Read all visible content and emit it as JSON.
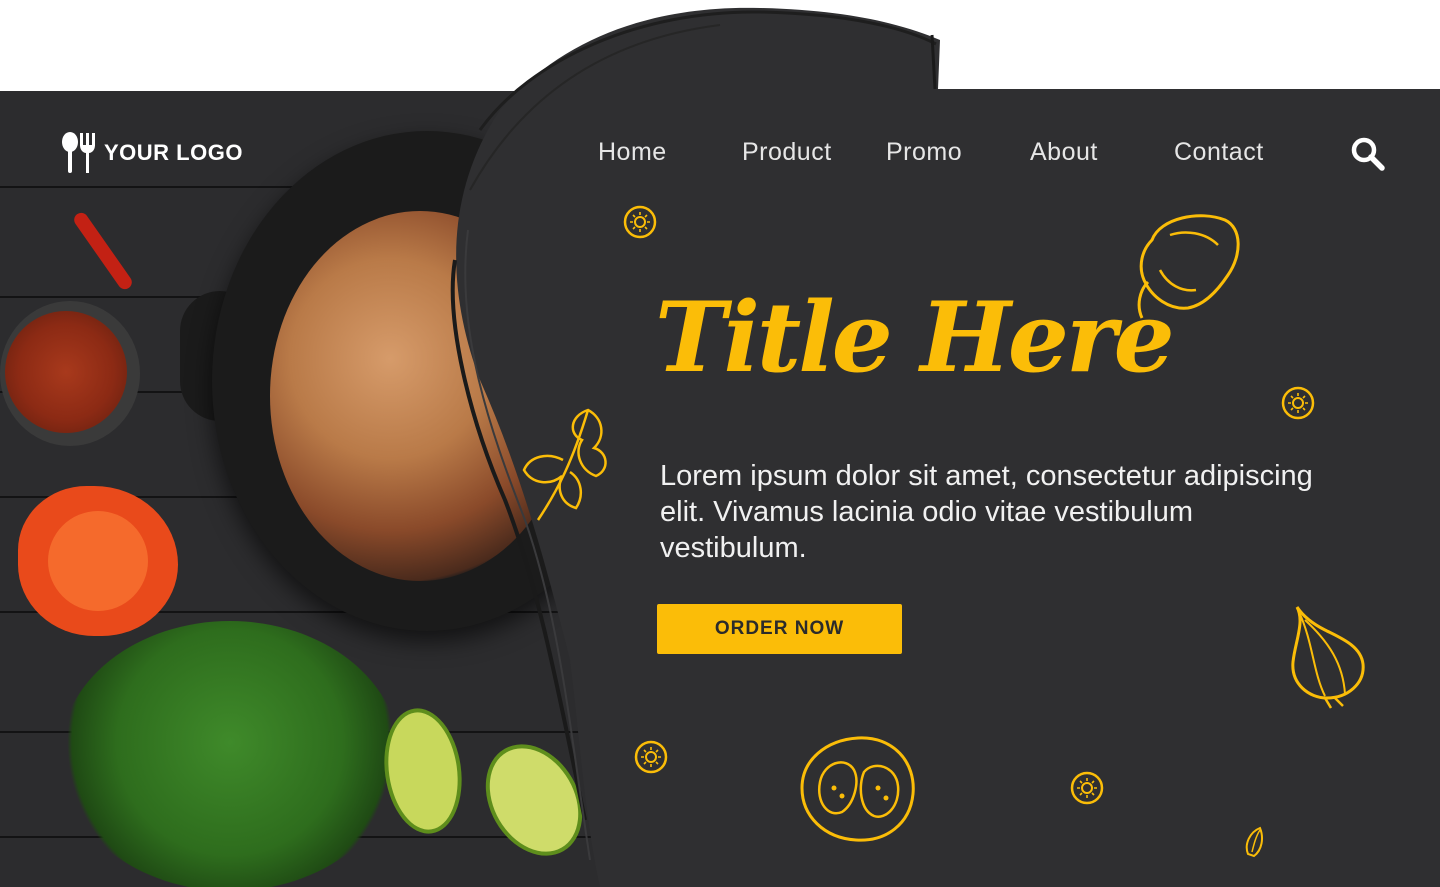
{
  "brand": {
    "logo_text": "YOUR LOGO"
  },
  "nav": {
    "items": [
      "Home",
      "Product",
      "Promo",
      "About",
      "Contact"
    ]
  },
  "hero": {
    "title": "Title Here",
    "body": "Lorem ipsum dolor sit amet, consectetur adipiscing elit. Vivamus lacinia odio vitae vestibulum vestibulum.",
    "cta_label": "ORDER NOW"
  },
  "colors": {
    "panel": "#2f2f31",
    "accent": "#fbbd08",
    "text": "#f1f1f1",
    "white": "#ffffff"
  },
  "icons": [
    "fork-spoon-icon",
    "search-icon",
    "tomato-slice-icon",
    "bell-pepper-icon",
    "parsley-icon",
    "onion-icon",
    "garlic-clove-icon"
  ]
}
